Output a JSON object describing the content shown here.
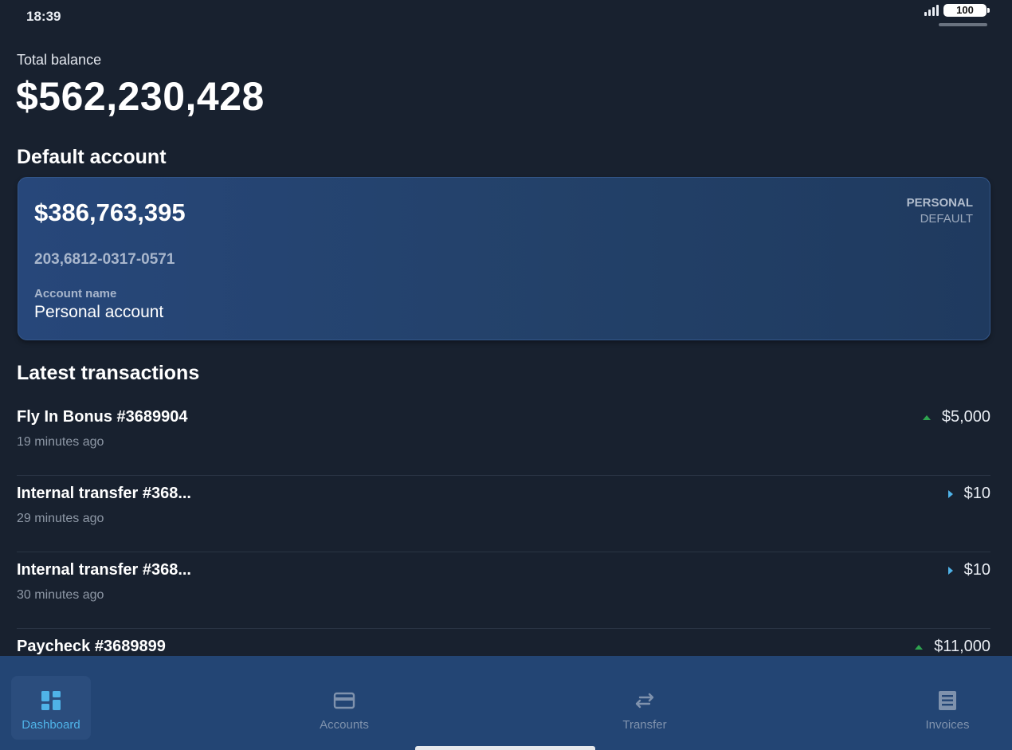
{
  "status": {
    "time": "18:39",
    "battery": "100"
  },
  "total": {
    "label": "Total balance",
    "value": "$562,230,428"
  },
  "default_account": {
    "section_title": "Default account",
    "balance": "$386,763,395",
    "number": "203,6812-0317-0571",
    "name_label": "Account name",
    "name": "Personal account",
    "type": "PERSONAL",
    "tag": "DEFAULT"
  },
  "transactions": {
    "section_title": "Latest transactions",
    "items": [
      {
        "title": "Fly In Bonus #3689904",
        "time": "19 minutes ago",
        "amount": "$5,000",
        "direction": "incoming"
      },
      {
        "title": "Internal transfer #368...",
        "time": "29 minutes ago",
        "amount": "$10",
        "direction": "transfer"
      },
      {
        "title": "Internal transfer #368...",
        "time": "30 minutes ago",
        "amount": "$10",
        "direction": "transfer"
      },
      {
        "title": "Paycheck #3689899",
        "time": "",
        "amount": "$11,000",
        "direction": "incoming"
      }
    ]
  },
  "nav": {
    "items": [
      {
        "label": "Dashboard",
        "icon": "dashboard-icon",
        "active": true
      },
      {
        "label": "Accounts",
        "icon": "credit-card-icon",
        "active": false
      },
      {
        "label": "Transfer",
        "icon": "transfer-arrows-icon",
        "active": false
      },
      {
        "label": "Invoices",
        "icon": "invoice-icon",
        "active": false
      }
    ]
  },
  "colors": {
    "background": "#18212f",
    "card": "#27477a",
    "nav_bar": "#234574",
    "accent": "#4fb3e8",
    "incoming": "#2ea44f"
  }
}
